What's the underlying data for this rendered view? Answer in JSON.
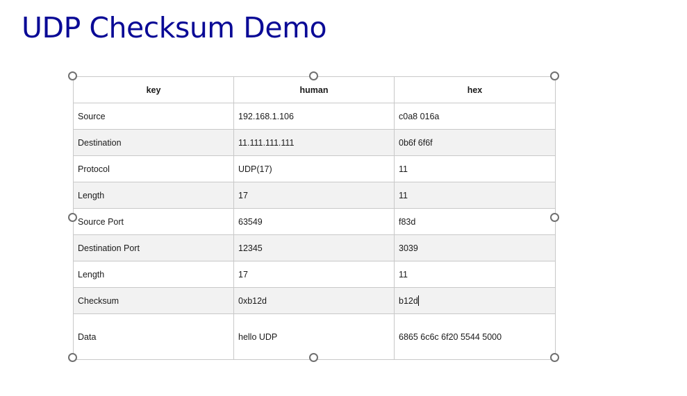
{
  "slide": {
    "title": "UDP Checksum Demo"
  },
  "table": {
    "headers": [
      "key",
      "human",
      "hex"
    ],
    "rows": [
      [
        "Source",
        "192.168.1.106",
        "c0a8 016a"
      ],
      [
        "Destination",
        "11.111.111.111",
        "0b6f 6f6f"
      ],
      [
        "Protocol",
        "UDP(17)",
        "11"
      ],
      [
        "Length",
        "17",
        "11"
      ],
      [
        "Source Port",
        "63549",
        "f83d"
      ],
      [
        "Destination Port",
        "12345",
        "3039"
      ],
      [
        "Length",
        "17",
        "11"
      ],
      [
        "Checksum",
        "0xb12d",
        "b12d"
      ],
      [
        "Data",
        "hello UDP",
        "6865 6c6c 6f20 5544 5000"
      ]
    ]
  },
  "colors": {
    "title": "#0a0a96",
    "row_shade": "#f2f2f2",
    "grid": "#c8c8c8",
    "handle_border": "#707070"
  }
}
